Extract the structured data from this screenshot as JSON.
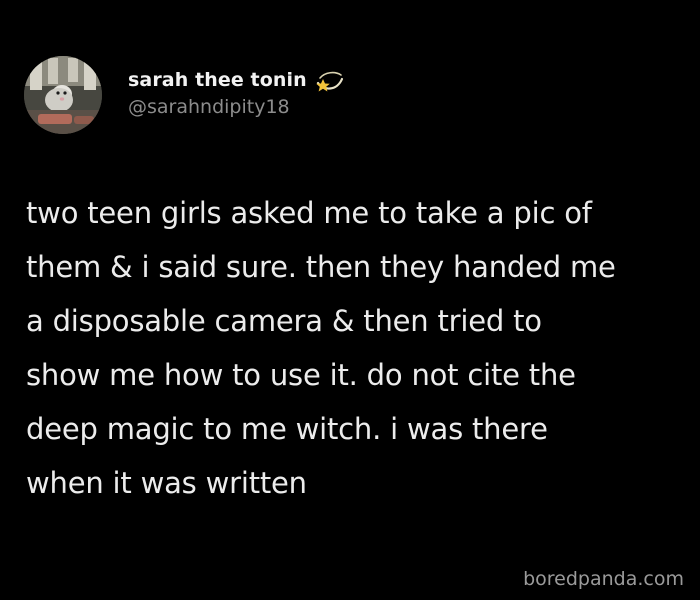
{
  "tweet": {
    "author": {
      "display_name": "sarah thee tonin",
      "handle": "@sarahndipity18",
      "name_emoji": "dizzy-star-emoji"
    },
    "text_lines": [
      "two teen girls asked me to take a pic of",
      "them & i said sure. then they handed me",
      "a disposable camera & then tried to",
      "show me how to use it. do not cite the",
      "deep magic to me witch. i was there",
      "when it was written"
    ]
  },
  "watermark": "boredpanda.com",
  "colors": {
    "background": "#000000",
    "text": "#ececec",
    "handle": "#8c8c8c",
    "watermark": "#9a9a9a"
  }
}
